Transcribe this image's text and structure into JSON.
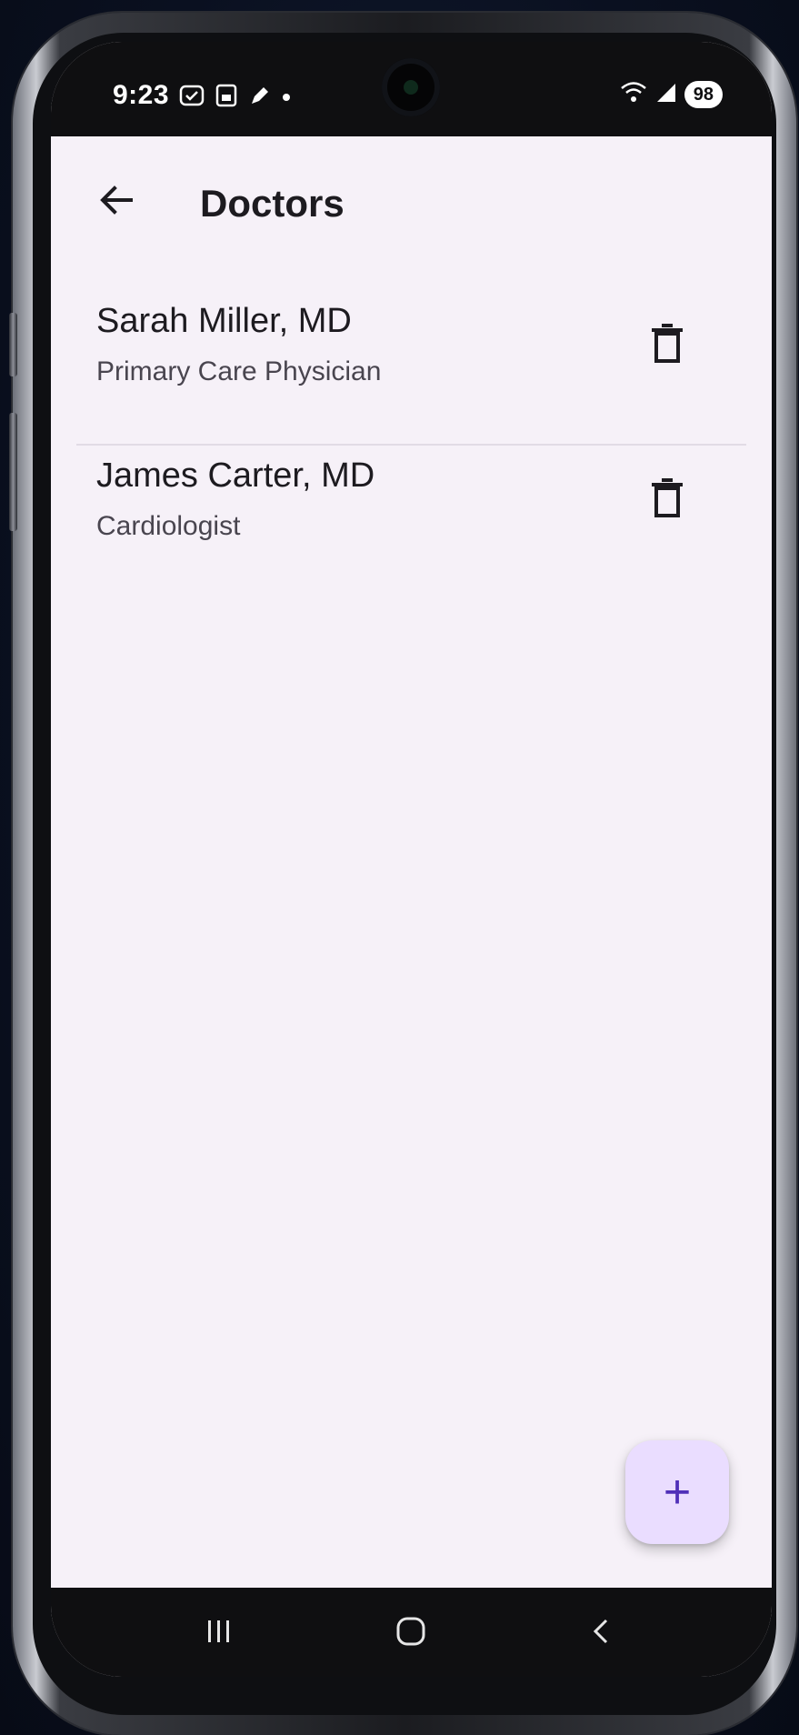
{
  "status_bar": {
    "time": "9:23",
    "battery": "98",
    "left_icons": [
      "sync-icon",
      "screenshot-icon",
      "pen-icon",
      "dot-icon"
    ],
    "right_icons": [
      "wifi-icon",
      "signal-icon"
    ]
  },
  "app_bar": {
    "title": "Doctors",
    "back_icon": "arrow-back-icon"
  },
  "doctors": [
    {
      "name": "Sarah Miller, MD",
      "specialty": "Primary Care Physician"
    },
    {
      "name": "James Carter, MD",
      "specialty": "Cardiologist"
    }
  ],
  "fab": {
    "label": "+",
    "icon": "add-icon",
    "color": "#eaddff",
    "icon_color": "#4f2fb8"
  },
  "nav_bar": {
    "buttons": [
      "recents-icon",
      "home-icon",
      "back-icon"
    ]
  },
  "colors": {
    "background": "#f6f1f8",
    "text_primary": "#1d1b20",
    "text_secondary": "#49454f"
  }
}
